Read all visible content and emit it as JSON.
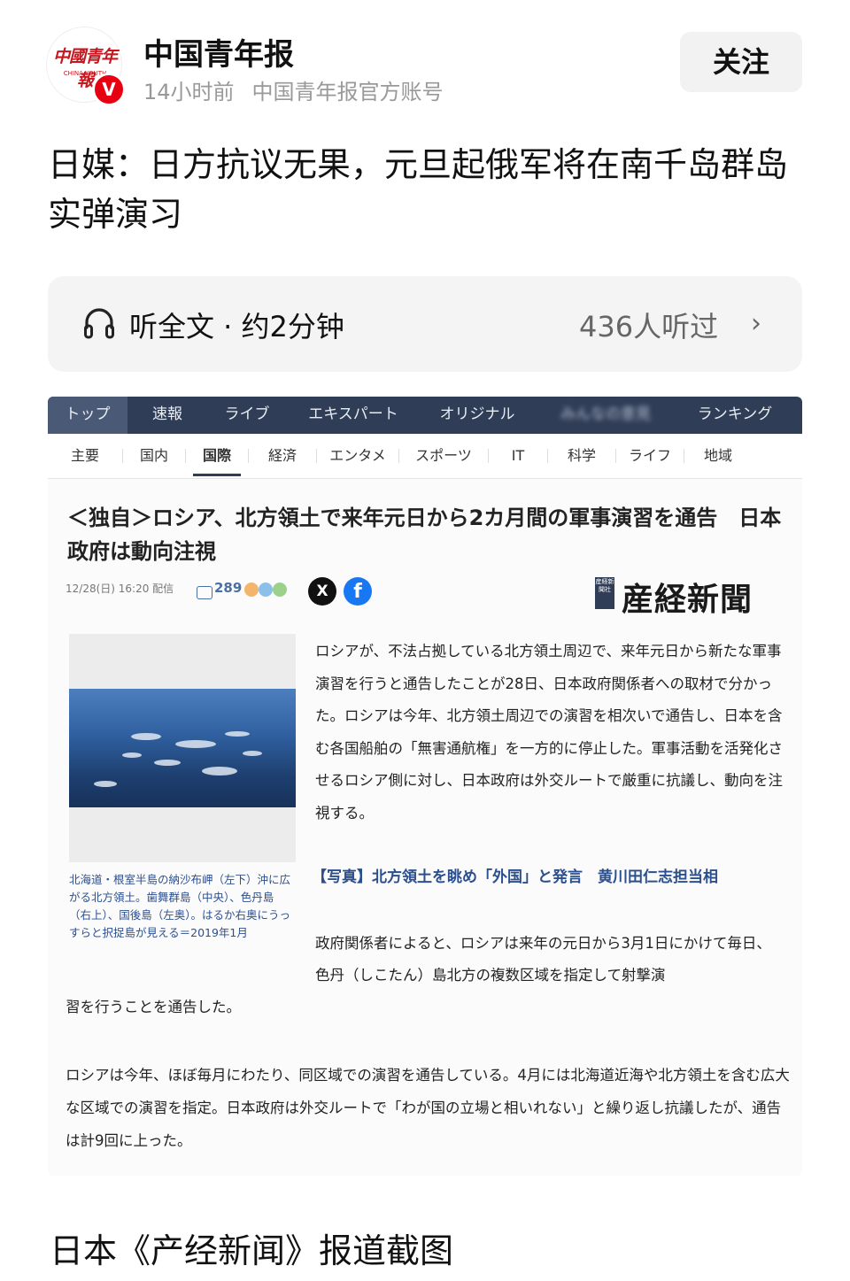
{
  "account": {
    "name": "中国青年报",
    "time": "14小时前",
    "desc": "中国青年报官方账号",
    "avatar_text": "中國青年報",
    "avatar_sub": "CHINA YOUTH",
    "verified_badge": "V",
    "follow_label": "关注"
  },
  "post": {
    "title": "日媒：日方抗议无果，元旦起俄军将在南千岛群岛实弹演习",
    "caption": "日本《产经新闻》报道截图"
  },
  "listen": {
    "label": "听全文 · 约2分钟",
    "count": "436人听过",
    "icon": "headphones-icon"
  },
  "screenshot": {
    "top_nav": [
      "トップ",
      "速報",
      "ライブ",
      "エキスパート",
      "オリジナル",
      "みんなの意見",
      "ランキング"
    ],
    "sub_nav": [
      "主要",
      "国内",
      "国際",
      "経済",
      "エンタメ",
      "スポーツ",
      "IT",
      "科学",
      "ライフ",
      "地域"
    ],
    "active_sub": "国際",
    "headline": "＜独自＞ロシア、北方領土で来年元日から2カ月間の軍事演習を通告　日本政府は動向注視",
    "date": "12/28(日) 16:20 配信",
    "comments": "289",
    "social": [
      "x-icon",
      "facebook-icon"
    ],
    "source_mark": "産経新聞社",
    "source": "産経新聞",
    "photo_caption": "北海道・根室半島の納沙布岬（左下）沖に広がる北方領土。歯舞群島（中央）、色丹島（右上）、国後島（左奥）。はるか右奥にうっすらと択捉島が見える＝2019年1月",
    "paragraph1": "ロシアが、不法占拠している北方領土周辺で、来年元日から新たな軍事演習を行うと通告したことが28日、日本政府関係者への取材で分かった。ロシアは今年、北方領土周辺での演習を相次いで通告し、日本を含む各国船舶の「無害通航権」を一方的に停止した。軍事活動を活発化させるロシア側に対し、日本政府は外交ルートで厳重に抗議し、動向を注視する。",
    "photo_link": "【写真】北方領土を眺め「外国」と発言　黄川田仁志担当相",
    "paragraph2a": "政府関係者によると、ロシアは来年の元日から3月1日にかけて毎日、色丹（しこたん）島北方の複数区域を指定して射撃演",
    "paragraph2b": "習を行うことを通告した。",
    "paragraph3": "ロシアは今年、ほぼ毎月にわたり、同区域での演習を通告している。4月には北海道近海や北方領土を含む広大な区域での演習を指定。日本政府は外交ルートで「わが国の立場と相いれない」と繰り返し抗議したが、通告は計9回に上った。"
  },
  "colors": {
    "brand_red": "#c8161e",
    "nav_dark": "#2f3d57",
    "link_blue": "#2c4f8f"
  }
}
